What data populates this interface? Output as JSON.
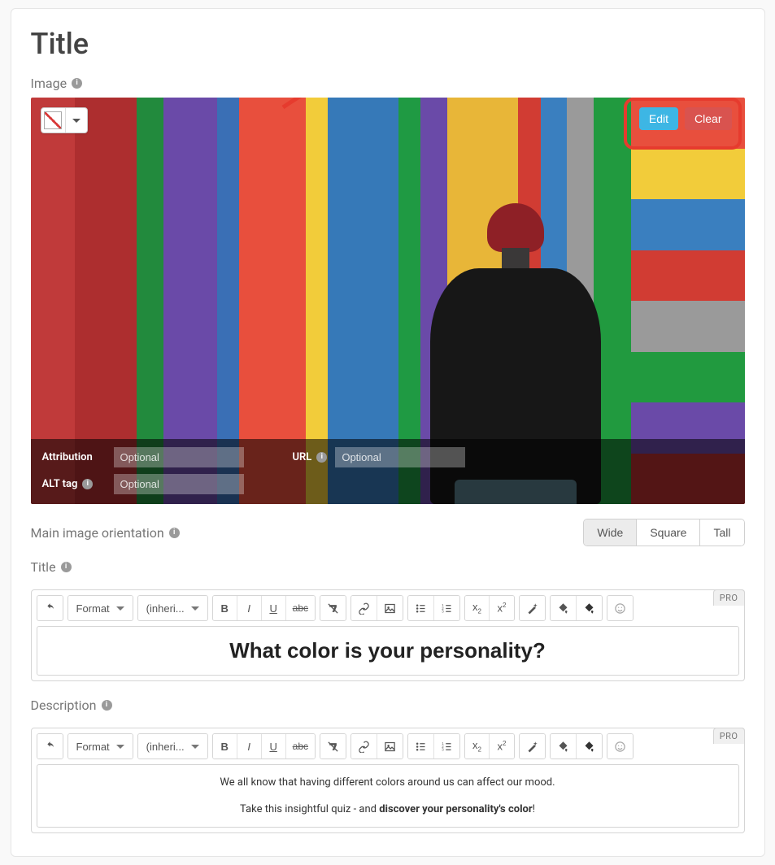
{
  "page": {
    "title": "Title"
  },
  "image_section": {
    "label": "Image",
    "edit_label": "Edit",
    "clear_label": "Clear",
    "attribution_label": "Attribution",
    "attribution_placeholder": "Optional",
    "url_label": "URL",
    "url_placeholder": "Optional",
    "alt_label": "ALT tag",
    "alt_placeholder": "Optional"
  },
  "orientation": {
    "label": "Main image orientation",
    "options": [
      "Wide",
      "Square",
      "Tall"
    ],
    "selected": "Wide"
  },
  "title_section": {
    "label": "Title",
    "pro_badge": "PRO",
    "format_label": "Format",
    "inherit_label": "(inheri...",
    "content": "What color is your personality?"
  },
  "description_section": {
    "label": "Description",
    "pro_badge": "PRO",
    "format_label": "Format",
    "inherit_label": "(inheri...",
    "line1": "We all know that having different colors around us can affect our mood.",
    "line2_pre": "Take this insightful quiz - and ",
    "line2_bold": "discover your personality's color",
    "line2_post": "!"
  },
  "stripes": [
    "#c03a3a",
    "#ad2e2f",
    "#228a3d",
    "#6a4aa8",
    "#3a6fb5",
    "#e84f3d",
    "#f2cc3a",
    "#3679b8",
    "#1f9a43",
    "#6a4aa8",
    "#e8b638",
    "#d13c33",
    "#3a7fbf",
    "#9a9a9a",
    "#219a3f",
    "#7352b0",
    "#c03232"
  ],
  "bands": [
    "#f2cc3a",
    "#3a7fbf",
    "#d13c33",
    "#9a9a9a",
    "#219a3f",
    "#6a4aa8",
    "#b83030"
  ]
}
